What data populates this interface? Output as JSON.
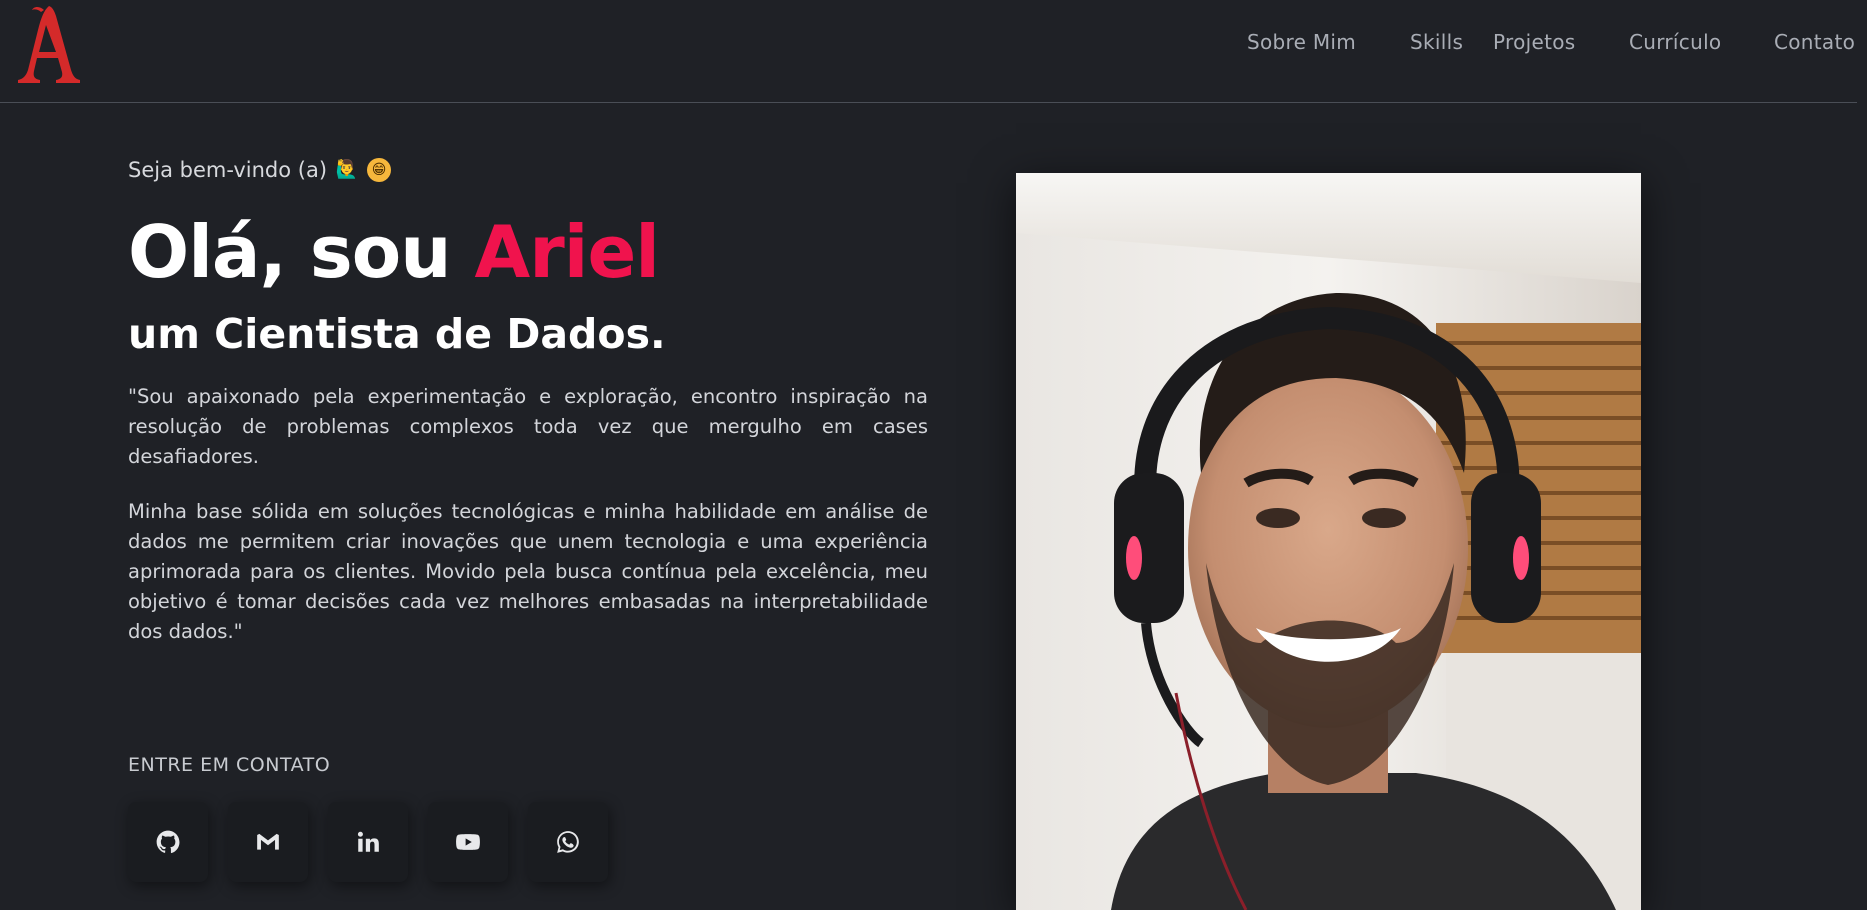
{
  "header": {
    "logo_letter": "A",
    "nav": [
      {
        "label": "Sobre Mim"
      },
      {
        "label": "Skills"
      },
      {
        "label": "Projetos"
      },
      {
        "label": "Currículo"
      },
      {
        "label": "Contato"
      }
    ]
  },
  "hero": {
    "welcome": "Seja bem-vindo (a)",
    "welcome_emojis": [
      "🙋‍♂️",
      "😁"
    ],
    "title_prefix": "Olá, sou ",
    "title_name": "Ariel",
    "subtitle": "um Cientista de Dados.",
    "paragraphs": [
      "\"Sou apaixonado pela experimentação e exploração, encontro inspiração na resolução de problemas complexos toda vez que mergulho em cases desafiadores.",
      "Minha base sólida em soluções tecnológicas e minha habilidade em análise de dados me permitem criar inovações que unem tecnologia e uma experiência aprimorada para os clientes. Movido pela busca contínua pela excelência, meu objetivo é tomar decisões cada vez melhores embasadas na interpretabilidade dos dados.\""
    ]
  },
  "contact": {
    "label": "ENTRE EM CONTATO",
    "links": [
      {
        "icon": "github-icon"
      },
      {
        "icon": "gmail-icon"
      },
      {
        "icon": "linkedin-icon"
      },
      {
        "icon": "youtube-icon"
      },
      {
        "icon": "whatsapp-icon"
      }
    ]
  },
  "colors": {
    "background": "#1f2126",
    "accent": "#f0134d",
    "nav_text": "#a9adb5",
    "logo": "#d42a2a"
  }
}
